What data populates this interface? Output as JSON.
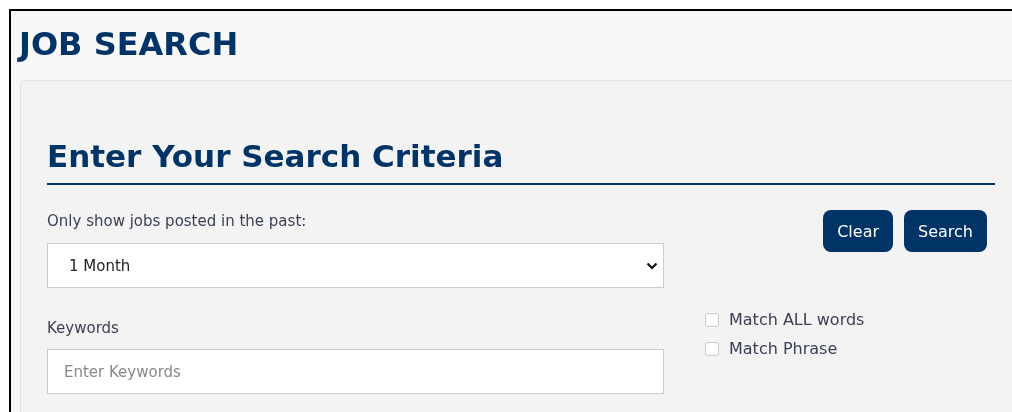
{
  "page_title": "JOB SEARCH",
  "panel": {
    "heading": "Enter Your Search Criteria",
    "period": {
      "label": "Only show jobs posted in the past:",
      "value": "1 Month"
    },
    "keywords": {
      "label": "Keywords",
      "placeholder": "Enter Keywords"
    },
    "buttons": [
      {
        "label": "Clear"
      },
      {
        "label": "Search"
      }
    ],
    "options": [
      {
        "label": "Match ALL words",
        "checked": false
      },
      {
        "label": "Match Phrase",
        "checked": false
      }
    ]
  }
}
